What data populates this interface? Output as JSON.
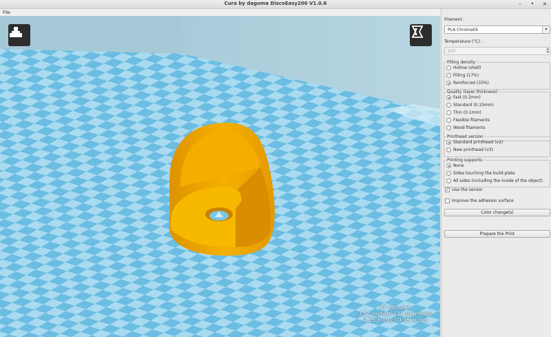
{
  "window": {
    "title": "Cura by dagoma DiscoEasy200 V1.0.6",
    "controls": [
      "-",
      "•",
      "×"
    ]
  },
  "menu": {
    "file": "File"
  },
  "stats": {
    "line1": "47 minutes",
    "line2": "3.54 meters / 11 grammes",
    "line3": "0.35 euros / 0.35 euros"
  },
  "sidebar": {
    "filament_label": "Filament :",
    "filament_value": "PLA Chromatik",
    "temperature_label": "Temperature (°C) :",
    "temperature_value": "205",
    "filling": {
      "title": "Filling density :",
      "options": [
        {
          "label": "Hollow (shell)",
          "selected": false
        },
        {
          "label": "Filling (17%)",
          "selected": false
        },
        {
          "label": "Reinforced  (33%)",
          "selected": true
        }
      ]
    },
    "quality": {
      "title": "Quality (layer thickness) :",
      "options": [
        {
          "label": "Fast (0.2mm)",
          "selected": true
        },
        {
          "label": "Standard (0.15mm)",
          "selected": false
        },
        {
          "label": "Thin (0.1mm)",
          "selected": false
        },
        {
          "label": "Flexible filaments",
          "selected": false
        },
        {
          "label": "Wood filaments",
          "selected": false
        }
      ]
    },
    "printhead": {
      "title": "Printhead version :",
      "options": [
        {
          "label": "Standard printhead (v2)",
          "selected": true
        },
        {
          "label": "New printhead (v3)",
          "selected": false
        }
      ]
    },
    "supports": {
      "title": "Printing supports :",
      "options": [
        {
          "label": "None",
          "selected": true
        },
        {
          "label": "Sides touching the build plate",
          "selected": false
        },
        {
          "label": "All sides (including the inside of the object)",
          "selected": false
        }
      ]
    },
    "use_sensor": {
      "label": "Use the sensor",
      "checked": true
    },
    "adhesion": {
      "label": "Improve the adhesion surface",
      "checked": false
    },
    "color_change_button": "Color change(s)",
    "prepare_button": "Prepare the Print"
  },
  "colors": {
    "model": "#f3a800",
    "plate_light": "#a9daf0",
    "plate_dark": "#66b9e0",
    "wall": "#b9d4df"
  },
  "icons": {
    "left_view_button": "load-model-icon",
    "right_view_button": "view-mode-icon"
  }
}
